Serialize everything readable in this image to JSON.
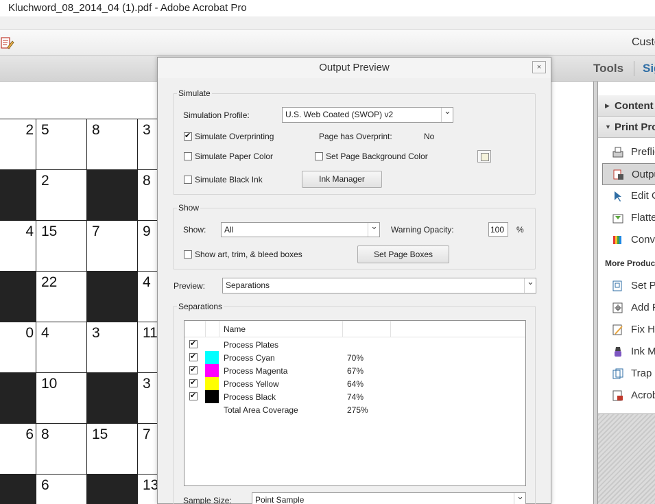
{
  "window": {
    "title": "Kluchword_08_2014_04 (1).pdf - Adobe Acrobat Pro"
  },
  "toolbar": {
    "customize_label": "Custo"
  },
  "nav": {
    "tools_label": "Tools",
    "sign_label": "Sig"
  },
  "crossword": {
    "rows": [
      {
        "cells": [
          {
            "t": "2",
            "black": false,
            "cut": true
          },
          {
            "t": "5",
            "black": false
          },
          {
            "t": "8",
            "black": false
          },
          {
            "t": "3",
            "black": false
          }
        ]
      },
      {
        "cells": [
          {
            "t": "",
            "black": true
          },
          {
            "t": "2",
            "black": false
          },
          {
            "t": "",
            "black": true
          },
          {
            "t": "8",
            "black": false
          }
        ]
      },
      {
        "cells": [
          {
            "t": "4",
            "black": false,
            "cut": true
          },
          {
            "t": "15",
            "black": false
          },
          {
            "t": "7",
            "black": false
          },
          {
            "t": "9",
            "black": false
          }
        ]
      },
      {
        "cells": [
          {
            "t": "",
            "black": true
          },
          {
            "t": "22",
            "black": false
          },
          {
            "t": "",
            "black": true
          },
          {
            "t": "4",
            "black": false
          }
        ]
      },
      {
        "cells": [
          {
            "t": "0",
            "black": false,
            "cut": true
          },
          {
            "t": "4",
            "black": false
          },
          {
            "t": "3",
            "black": false
          },
          {
            "t": "11",
            "black": false
          }
        ]
      },
      {
        "cells": [
          {
            "t": "",
            "black": true
          },
          {
            "t": "10",
            "black": false
          },
          {
            "t": "",
            "black": true
          },
          {
            "t": "3",
            "black": false
          }
        ]
      },
      {
        "cells": [
          {
            "t": "6",
            "black": false,
            "cut": true
          },
          {
            "t": "8",
            "black": false
          },
          {
            "t": "15",
            "black": false
          },
          {
            "t": "7",
            "black": false
          }
        ]
      },
      {
        "cells": [
          {
            "t": "",
            "black": true
          },
          {
            "t": "6",
            "black": false
          },
          {
            "t": "",
            "black": true
          },
          {
            "t": "13",
            "black": false
          }
        ]
      }
    ]
  },
  "right_panel": {
    "sections": [
      {
        "label": "Content"
      },
      {
        "label": "Print Pro"
      }
    ],
    "items": [
      {
        "label": "Prefligh",
        "icon": "preflight-icon"
      },
      {
        "label": "Outpu",
        "icon": "output-preview-icon",
        "selected": true
      },
      {
        "label": "Edit O",
        "icon": "edit-object-icon"
      },
      {
        "label": "Flatte",
        "icon": "flattener-icon"
      },
      {
        "label": "Conve",
        "icon": "convert-colors-icon"
      }
    ],
    "more_label": "More Product",
    "more_items": [
      {
        "label": "Set Pa",
        "icon": "set-page-boxes-icon"
      },
      {
        "label": "Add P",
        "icon": "add-printer-marks-icon"
      },
      {
        "label": "Fix Ha",
        "icon": "fix-hairlines-icon"
      },
      {
        "label": "Ink M",
        "icon": "ink-manager-icon"
      },
      {
        "label": "Trap P",
        "icon": "trap-presets-icon"
      },
      {
        "label": "Acrob",
        "icon": "acrobat-distiller-icon"
      }
    ]
  },
  "dialog": {
    "title": "Output Preview",
    "close_label": "×",
    "simulate": {
      "group_label": "Simulate",
      "profile_label": "Simulation Profile:",
      "profile_value": "U.S. Web Coated (SWOP) v2",
      "overprint_label": "Simulate Overprinting",
      "overprint_checked": true,
      "has_overprint_label": "Page has Overprint:",
      "has_overprint_value": "No",
      "paper_color_label": "Simulate Paper Color",
      "page_bg_label": "Set Page Background Color",
      "black_ink_label": "Simulate Black Ink",
      "ink_manager_label": "Ink Manager"
    },
    "show": {
      "group_label": "Show",
      "show_label": "Show:",
      "show_value": "All",
      "warning_label": "Warning Opacity:",
      "warning_value": "100",
      "percent_sign": "%",
      "boxes_label": "Show art, trim, & bleed boxes",
      "set_boxes_label": "Set Page Boxes"
    },
    "preview": {
      "label": "Preview:",
      "value": "Separations"
    },
    "separations": {
      "group_label": "Separations",
      "name_header": "Name",
      "rows": [
        {
          "name": "Process Plates",
          "pct": "",
          "color": "",
          "checked": true
        },
        {
          "name": "Process Cyan",
          "pct": "70%",
          "color": "#00ffff",
          "checked": true
        },
        {
          "name": "Process Magenta",
          "pct": "67%",
          "color": "#ff00ff",
          "checked": true
        },
        {
          "name": "Process Yellow",
          "pct": "64%",
          "color": "#ffff00",
          "checked": true
        },
        {
          "name": "Process Black",
          "pct": "74%",
          "color": "#000000",
          "checked": true
        },
        {
          "name": "Total Area Coverage",
          "pct": "275%",
          "color": "",
          "checked": false,
          "nocheck": true
        }
      ]
    },
    "sample": {
      "label": "Sample Size:",
      "value": "Point Sample"
    }
  }
}
